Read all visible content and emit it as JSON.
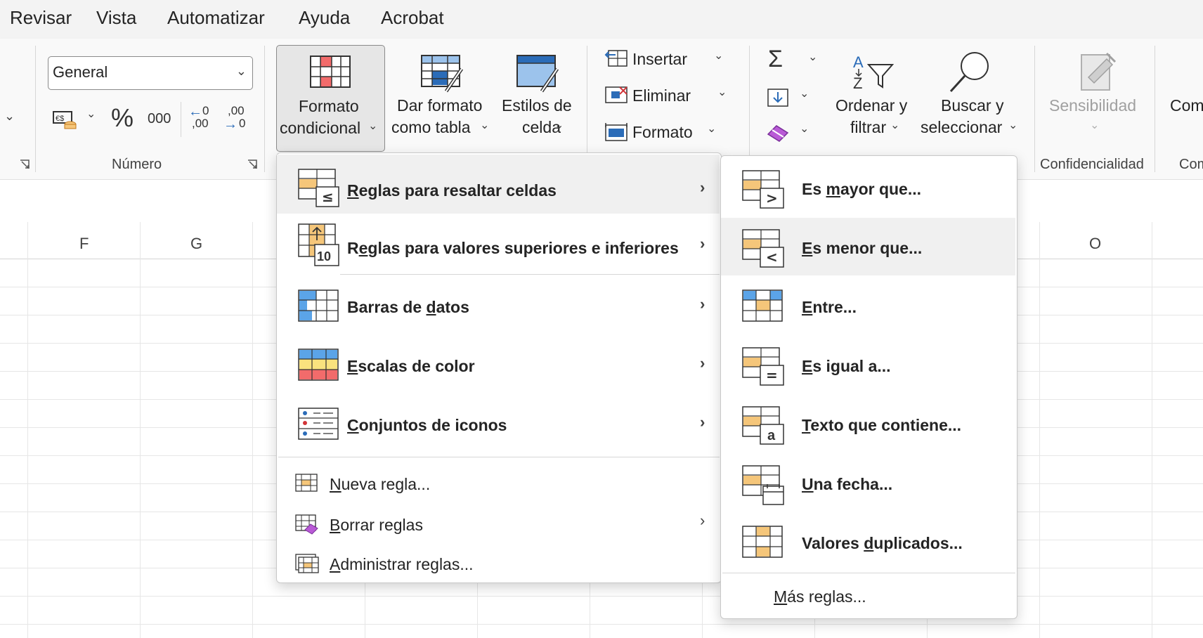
{
  "menubar": {
    "tabs": [
      "Revisar",
      "Vista",
      "Automatizar",
      "Ayuda",
      "Acrobat"
    ]
  },
  "ribbon": {
    "number_format": "General",
    "percent_symbol": "%",
    "thousands_label": "000",
    "increase_decimal_label": ",00",
    "decrease_decimal_label": ",00",
    "numero_group": "Número",
    "conditional_format": [
      "Formato",
      "condicional"
    ],
    "format_as_table": [
      "Dar formato",
      "como tabla"
    ],
    "cell_styles": [
      "Estilos de",
      "celda"
    ],
    "insert": "Insertar",
    "delete": "Eliminar",
    "format": "Formato",
    "sort_filter": [
      "Ordenar y",
      "filtrar"
    ],
    "find_select": [
      "Buscar y",
      "seleccionar"
    ],
    "sensitivity": "Sensibilidad",
    "confidentiality_group": "Confidencialidad",
    "cut_right_label": "Com",
    "cut_right_group": "Com"
  },
  "grid": {
    "columns": [
      "F",
      "G",
      "O"
    ]
  },
  "cf_menu": {
    "items": [
      {
        "pre": "",
        "u": "R",
        "post": "eglas para resaltar celdas"
      },
      {
        "pre": "R",
        "u": "e",
        "post": "glas para valores superiores e inferiores"
      },
      {
        "pre": "Barras de ",
        "u": "d",
        "post": "atos"
      },
      {
        "pre": "",
        "u": "E",
        "post": "scalas de color"
      },
      {
        "pre": "",
        "u": "C",
        "post": "onjuntos de iconos"
      }
    ],
    "bottom_items": [
      {
        "pre": "",
        "u": "N",
        "post": "ueva regla..."
      },
      {
        "pre": "",
        "u": "B",
        "post": "orrar reglas"
      },
      {
        "pre": "",
        "u": "A",
        "post": "dministrar reglas..."
      }
    ]
  },
  "sub_menu": {
    "items": [
      {
        "pre": "Es ",
        "u": "m",
        "post": "ayor que..."
      },
      {
        "pre": "",
        "u": "E",
        "post": "s menor que..."
      },
      {
        "pre": "",
        "u": "E",
        "post": "ntre..."
      },
      {
        "pre": "",
        "u": "E",
        "post": "s igual a..."
      },
      {
        "pre": "",
        "u": "T",
        "post": "exto que contiene..."
      },
      {
        "pre": "",
        "u": "U",
        "post": "na fecha..."
      },
      {
        "pre": "Valores ",
        "u": "d",
        "post": "uplicados..."
      }
    ],
    "more": {
      "pre": "",
      "u": "M",
      "post": "ás reglas..."
    }
  },
  "colors": {
    "accent_blue": "#2b6cb8",
    "highlight_orange": "#f5c67a",
    "highlight_red": "#f26b6b",
    "hover_gray": "#f0f0f0"
  }
}
